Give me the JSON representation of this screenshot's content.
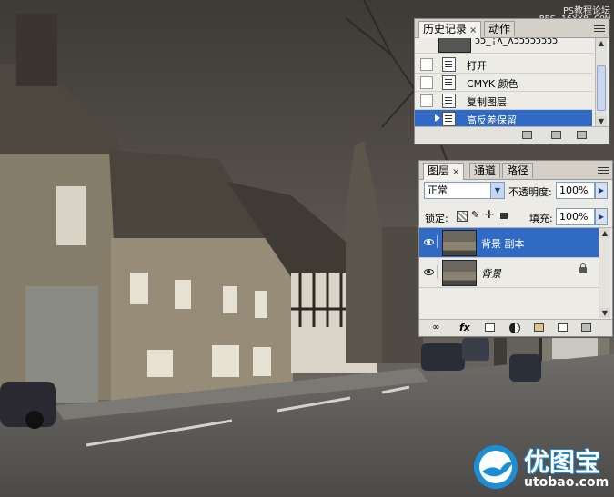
{
  "watermark": {
    "line1": "PS教程论坛",
    "line2": "BBS.16XX8.COM"
  },
  "history_panel": {
    "tabs": [
      {
        "label": "历史记录",
        "close": "×"
      },
      {
        "label": "动作"
      }
    ],
    "top_item": "ɔɔ_╎ʌ_ʌɔɔɔɔɔɔɔɔ",
    "items": [
      {
        "label": "打开"
      },
      {
        "label": "CMYK 颜色"
      },
      {
        "label": "复制图层"
      },
      {
        "label": "高反差保留"
      }
    ],
    "selected_index": 3
  },
  "layers_panel": {
    "tabs": [
      {
        "label": "图层",
        "close": "×"
      },
      {
        "label": "通道"
      },
      {
        "label": "路径"
      }
    ],
    "blend_mode": "正常",
    "opacity_label": "不透明度:",
    "opacity_value": "100%",
    "lock_label": "锁定:",
    "fill_label": "填充:",
    "fill_value": "100%",
    "layers": [
      {
        "name": "背景 副本",
        "selected": true,
        "visible": true
      },
      {
        "name": "背景",
        "selected": false,
        "visible": true,
        "locked": true
      }
    ],
    "bottom_buttons": [
      "link-icon",
      "fx-icon",
      "mask-icon",
      "adjustment-icon",
      "group-icon",
      "new-layer-icon",
      "trash-icon"
    ]
  },
  "logo": {
    "title": "优图宝",
    "url": "utobao.com"
  },
  "colors": {
    "selection": "#316ac5",
    "panel_bg": "#ecebe6",
    "logo_blue": "#1b8fd6"
  }
}
